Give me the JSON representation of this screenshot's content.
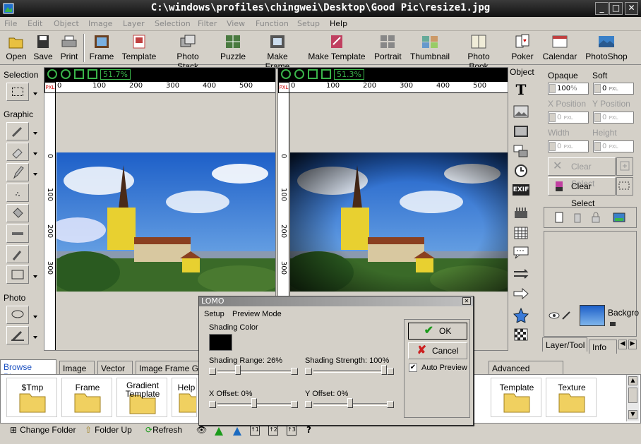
{
  "title": "C:\\windows\\profiles\\chingwei\\Desktop\\Good Pic\\resize1.jpg",
  "window_controls": {
    "minimize": "_",
    "maximize": "□",
    "close": "✕"
  },
  "menu": [
    "File",
    "Edit",
    "Object",
    "Image",
    "Layer",
    "Selection",
    "Filter",
    "View",
    "Function",
    "Setup",
    "Help"
  ],
  "toolbar": [
    "Open",
    "Save",
    "Print",
    "Frame",
    "Template",
    "Photo Stack",
    "Puzzle",
    "Make Frame",
    "Make Template",
    "Portrait",
    "Thumbnail",
    "Photo Book",
    "Poker",
    "Calendar",
    "PhotoShop"
  ],
  "left_panel": {
    "selection": "Selection",
    "graphic": "Graphic",
    "photo": "Photo"
  },
  "viewer_left": {
    "zoom": "51.7%",
    "unit": "PXL",
    "hticks": [
      "0",
      "100",
      "200",
      "300",
      "400",
      "500"
    ],
    "vticks": [
      "0",
      "100",
      "200",
      "300"
    ]
  },
  "viewer_right": {
    "zoom": "51.3%",
    "unit": "PXL",
    "hticks": [
      "0",
      "100",
      "200",
      "300",
      "400",
      "500"
    ],
    "vticks": [
      "0",
      "100",
      "200",
      "300"
    ]
  },
  "object_panel": {
    "label": "Object",
    "exif": "EXIF",
    "text_tool": "T"
  },
  "props": {
    "opaque": "Opaque",
    "soft": "Soft",
    "opaque_val": "100",
    "pct": "%",
    "soft_val": "0",
    "pxl": "PXL",
    "xpos": "X Position",
    "ypos": "Y Position",
    "xval": "0",
    "yval": "0",
    "width": "Width",
    "height": "Height",
    "wval": "0",
    "hval": "0",
    "clear_select1": "Clear Select",
    "clear_select2": "Clear Select"
  },
  "layer": {
    "name": "Backgro",
    "tab1": "Layer/Tool",
    "tab2": "Info"
  },
  "browser_tabs": [
    "Browse Photo",
    "Image",
    "Vector",
    "Image Frame Gall",
    "Advanced Function"
  ],
  "folders_left": [
    "$Tmp",
    "Frame",
    "Gradient Template",
    "Help"
  ],
  "folders_right": [
    "Template",
    "Texture"
  ],
  "bottom": {
    "change_folder": "Change Folder",
    "folder_up": "Folder Up",
    "refresh": "Refresh",
    "help": "?"
  },
  "dialog": {
    "title": "LOMO",
    "close": "✕",
    "menu1": "Setup",
    "menu2": "Preview Mode",
    "shading_color": "Shading Color",
    "shading_range": "Shading Range: 26%",
    "range_value": 26,
    "shading_strength": "Shading Strength: 100%",
    "strength_value": 100,
    "x_offset": "X Offset: 0%",
    "x_value": 0,
    "y_offset": "Y Offset: 0%",
    "y_value": 0,
    "ok": "OK",
    "cancel": "Cancel",
    "auto_preview": "Auto Preview"
  },
  "colors": {
    "zoom_green": "#3ab54a",
    "shading_color": "#000000",
    "ok_check": "#1a9a1a",
    "cancel_x": "#cc2020"
  }
}
